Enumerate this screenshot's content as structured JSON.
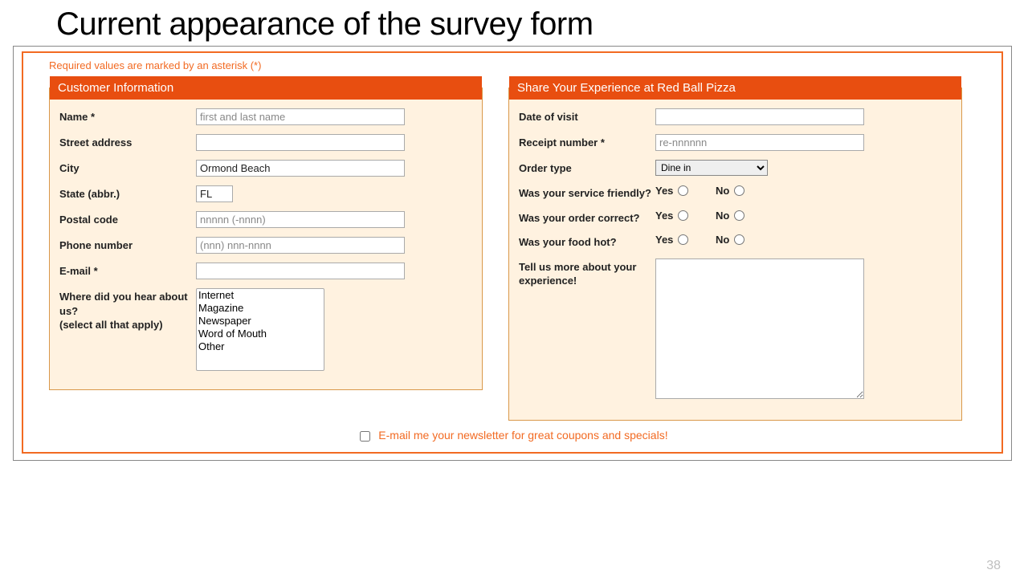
{
  "slide_title": "Current appearance of the survey form",
  "required_note": "Required values are marked by an asterisk (*)",
  "left": {
    "legend": "Customer Information",
    "name_label": "Name *",
    "name_placeholder": "first and last name",
    "street_label": "Street address",
    "city_label": "City",
    "city_value": "Ormond Beach",
    "state_label": "State (abbr.)",
    "state_value": "FL",
    "postal_label": "Postal code",
    "postal_placeholder": "nnnnn (-nnnn)",
    "phone_label": "Phone number",
    "phone_placeholder": "(nnn) nnn-nnnn",
    "email_label": "E-mail *",
    "hear_label": "Where did you hear about us?\n(select all that apply)",
    "hear_options": [
      "Internet",
      "Magazine",
      "Newspaper",
      "Word of Mouth",
      "Other"
    ]
  },
  "right": {
    "legend": "Share Your Experience at Red Ball Pizza",
    "date_label": "Date of visit",
    "receipt_label": "Receipt number *",
    "receipt_placeholder": "re-nnnnnn",
    "order_label": "Order type",
    "order_value": "Dine in",
    "q1": "Was your service friendly?",
    "q2": "Was your order correct?",
    "q3": "Was your food hot?",
    "yes": "Yes",
    "no": "No",
    "tell_label": "Tell us more about your experience!"
  },
  "footer": "E-mail me your newsletter for great coupons and specials!",
  "page_num": "38"
}
